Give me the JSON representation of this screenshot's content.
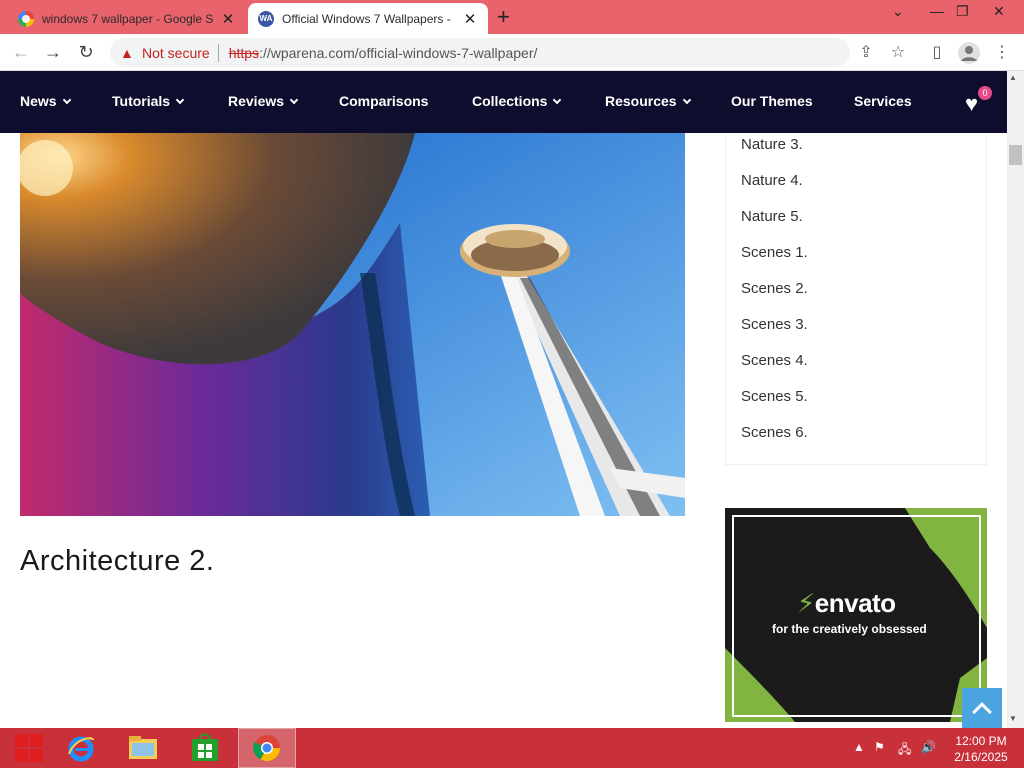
{
  "browser": {
    "tabs": [
      {
        "title": "windows 7 wallpaper - Google S",
        "favicon": "google-icon",
        "active": false
      },
      {
        "title": "Official Windows 7 Wallpapers -",
        "favicon": "wparena-icon",
        "active": true
      }
    ],
    "new_tab_symbol": "+",
    "address": {
      "security_label": "Not secure",
      "url_scheme": "https",
      "url_rest": "://wparena.com/official-windows-7-wallpaper/"
    }
  },
  "site_nav": {
    "items": [
      {
        "label": "News",
        "has_dropdown": true
      },
      {
        "label": "Tutorials",
        "has_dropdown": true
      },
      {
        "label": "Reviews",
        "has_dropdown": true
      },
      {
        "label": "Comparisons",
        "has_dropdown": false
      },
      {
        "label": "Collections",
        "has_dropdown": true
      },
      {
        "label": "Resources",
        "has_dropdown": true
      },
      {
        "label": "Our Themes",
        "has_dropdown": false
      },
      {
        "label": "Services",
        "has_dropdown": false
      }
    ],
    "wishlist_count": "0"
  },
  "main": {
    "section_heading": "Architecture 2."
  },
  "sidebar": {
    "links": [
      "Nature 3.",
      "Nature 4.",
      "Nature 5.",
      "Scenes 1.",
      "Scenes 2.",
      "Scenes 3.",
      "Scenes 4.",
      "Scenes 5.",
      "Scenes 6."
    ],
    "ad": {
      "brand": "envato",
      "tagline": "for the creatively obsessed"
    }
  },
  "taskbar": {
    "apps": [
      "start-icon",
      "internet-explorer-icon",
      "file-explorer-icon",
      "store-icon",
      "chrome-icon"
    ],
    "time": "12:00 PM",
    "date": "2/16/2025"
  },
  "colors": {
    "tabstrip": "#e8636b",
    "site_nav_bg": "#0f0d2e",
    "taskbar": "#c8303a",
    "envato_green": "#81b441",
    "to_top": "#4aa4df"
  }
}
